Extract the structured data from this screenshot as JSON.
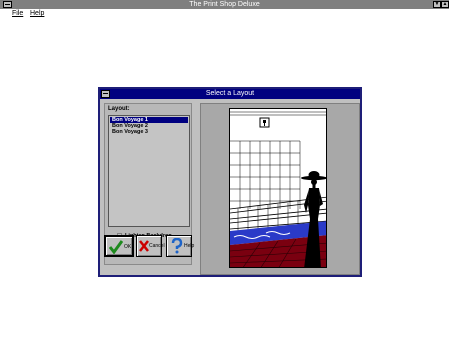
{
  "app": {
    "title": "The Print Shop Deluxe",
    "minimize_glyph": "▼",
    "maximize_glyph": "▲"
  },
  "menubar": {
    "file": "File",
    "help": "Help"
  },
  "dialog": {
    "title": "Select a Layout",
    "layout_label": "Layout:",
    "layouts": [
      {
        "label": "Bon Voyage 1",
        "selected": true
      },
      {
        "label": "Bon Voyage 2",
        "selected": false
      },
      {
        "label": "Bon Voyage 3",
        "selected": false
      }
    ],
    "lighten_backdrop": {
      "label": "Lighten Backdrop",
      "checked": false
    },
    "buttons": {
      "ok": "OK",
      "cancel": "Cancel",
      "help": "Help"
    }
  },
  "colors": {
    "titlebar": "#000080",
    "app_titlebar": "#7f7f7f",
    "face": "#c0c0c0",
    "ok_check": "#1e8a1e",
    "cancel_x": "#cc0000",
    "help_q": "#1e64c8"
  },
  "icons": {
    "ok": "check-icon",
    "cancel": "x-icon",
    "help": "question-icon"
  }
}
